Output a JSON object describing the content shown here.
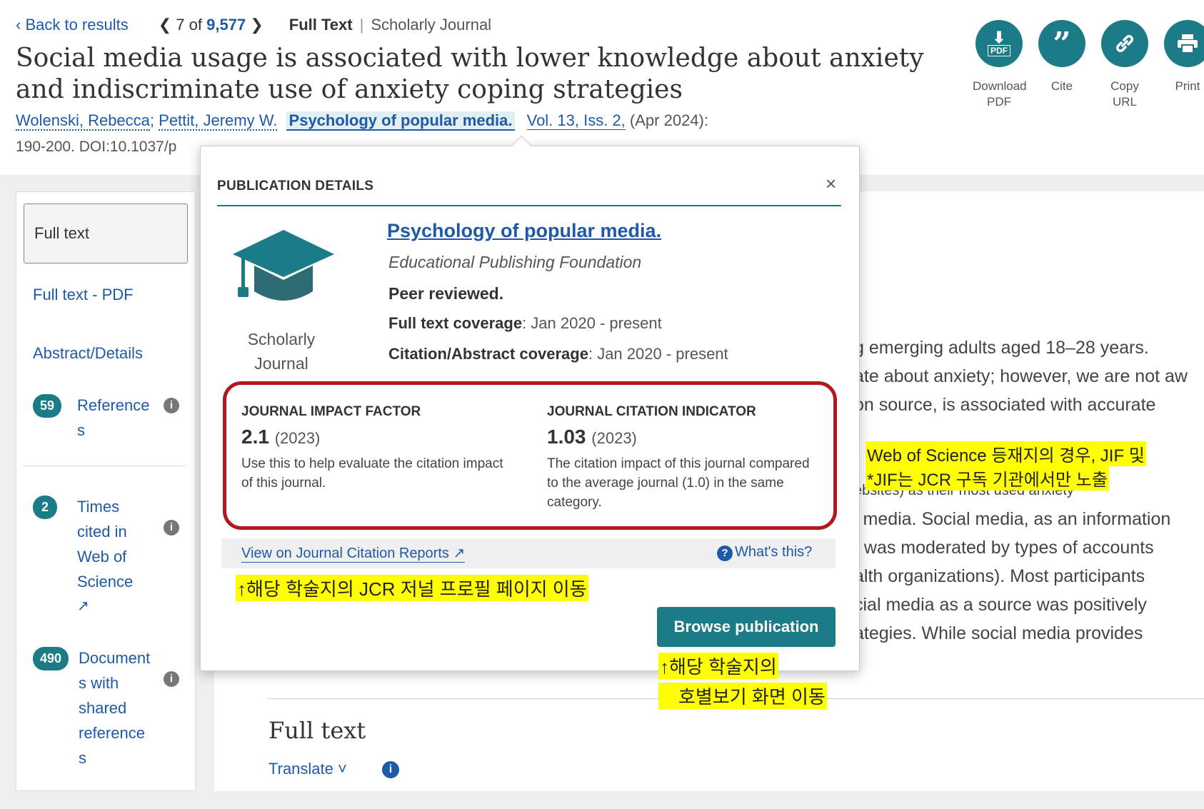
{
  "nav": {
    "back": "‹ Back to results",
    "prev": "❮",
    "position": "7",
    "of_text": "of",
    "total": "9,577",
    "next": "❯",
    "full_text": "Full Text",
    "separator": "|",
    "source_type": "Scholarly Journal"
  },
  "article": {
    "title": "Social media usage is associated with lower knowledge about anxiety and indiscriminate use of anxiety coping strategies",
    "author1": "Wolenski, Rebecca",
    "author2": "Pettit, Jeremy W.",
    "publication": "Psychology of popular media.",
    "volume": "Vol. 13, Iss. 2,",
    "date": "(Apr 2024):",
    "doi_line": "190-200. DOI:10.1037/p"
  },
  "actions": {
    "download": "Download PDF",
    "download_pdf_tag": "PDF",
    "cite": "Cite",
    "copy_url": "Copy URL",
    "print": "Print"
  },
  "sidebar": {
    "full_text": "Full text",
    "full_text_pdf": "Full text - PDF",
    "abstract": "Abstract/Details",
    "references_count": "59",
    "references_label": [
      "Reference",
      "s"
    ],
    "times_cited_count": "2",
    "times_cited_label": [
      "Times",
      "cited in",
      "Web of",
      "Science"
    ],
    "shared_count": "490",
    "shared_label": [
      "Document",
      "s with",
      "shared",
      "reference",
      "s"
    ]
  },
  "main": {
    "lines": [
      "g emerging adults aged 18–28 years.",
      "ate about anxiety; however, we are not aw",
      "on source, is associated with accurate",
      "ebsites) as their most used anxiety",
      "l media. Social media, as an information",
      "t was moderated by types of accounts",
      "alth organizations). Most participants",
      "cial media as a source was positively",
      "ategies. While social media provides"
    ],
    "full_text_heading": "Full text",
    "translate": "Translate ˅"
  },
  "popup": {
    "header": "PUBLICATION DETAILS",
    "close": "×",
    "journal_title": "Psychology of popular media.",
    "publisher": "Educational Publishing Foundation",
    "peer": "Peer reviewed.",
    "coverage_label": "Full text coverage",
    "coverage_value": ": Jan 2020 - present",
    "citation_label": "Citation/Abstract coverage",
    "citation_value": ": Jan 2020 - present",
    "type_line1": "Scholarly",
    "type_line2": "Journal",
    "jif_heading": "JOURNAL IMPACT FACTOR",
    "jif_value": "2.1",
    "jif_year": "(2023)",
    "jif_desc": "Use this to help evaluate the citation impact of this journal.",
    "jci_heading": "JOURNAL CITATION INDICATOR",
    "jci_value": "1.03",
    "jci_year": "(2023)",
    "jci_desc": "The citation impact of this journal compared to the average journal (1.0) in the same category.",
    "jcr_link": "View on Journal Citation Reports",
    "whats_this": "What's this?",
    "browse": "Browse publication"
  },
  "annotations": {
    "wos_line1": "Web of Science 등재지의 경우, JIF 및",
    "wos_line2": "*JIF는 JCR 구독 기관에서만 노출",
    "jcr_note": "↑해당 학술지의 JCR 저널 프로필 페이지 이동",
    "browse_note1": "↑해당 학술지의",
    "browse_note2": "호별보기 화면 이동"
  },
  "colors": {
    "teal": "#1b7b86",
    "link": "#1f5aa6",
    "highlight_box": "#b3181f",
    "annotation": "#ffff00"
  }
}
